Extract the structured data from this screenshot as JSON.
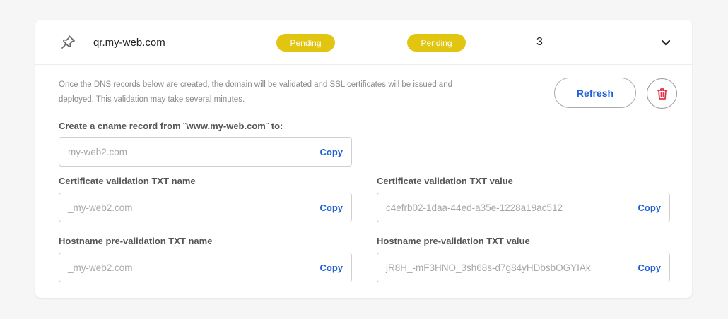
{
  "row": {
    "domain": "qr.my-web.com",
    "status1": "Pending",
    "status2": "Pending",
    "count": "3",
    "badge_color": "#e2c510"
  },
  "info": {
    "line1": "Once the DNS records below are created, the domain will be validated and SSL certificates will be issued and",
    "line2": "deployed. This validation may take several minutes."
  },
  "actions": {
    "refresh_label": "Refresh"
  },
  "cname": {
    "label": "Create a cname record from ¨www.my-web.com¨ to:",
    "value": "my-web2.com",
    "copy_label": "Copy"
  },
  "cert_name": {
    "label": "Certificate validation TXT name",
    "value": "_my-web2.com",
    "copy_label": "Copy"
  },
  "cert_value": {
    "label": "Certificate validation TXT value",
    "value": "c4efrb02-1daa-44ed-a35e-1228a19ac512",
    "copy_label": "Copy"
  },
  "host_name": {
    "label": "Hostname pre-validation TXT name",
    "value": "_my-web2.com",
    "copy_label": "Copy"
  },
  "host_value": {
    "label": "Hostname pre-validation TXT value",
    "value": "jR8H_-mF3HNO_3sh68s-d7g84yHDbsbOGYIAk",
    "copy_label": "Copy"
  },
  "colors": {
    "accent": "#1f5fd6",
    "delete": "#e0344a"
  },
  "icons": {
    "pin": "pin-icon",
    "chevron": "chevron-down-icon",
    "trash": "trash-icon"
  }
}
